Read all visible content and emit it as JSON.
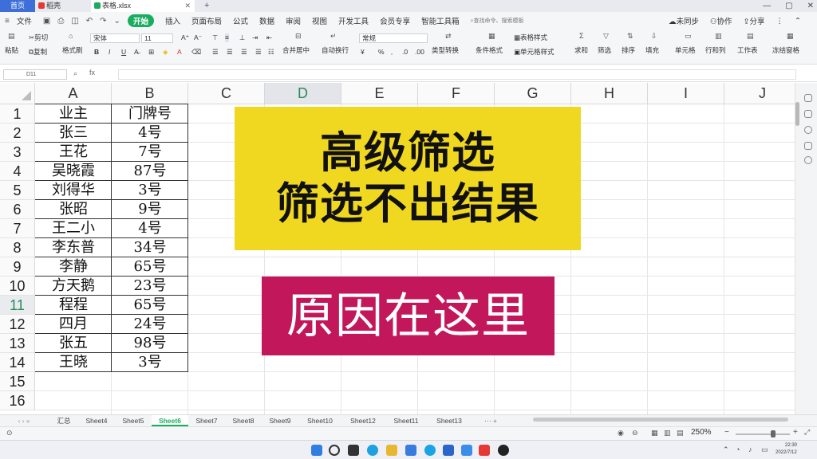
{
  "titlebar": {
    "tabs": [
      {
        "label": "首页"
      },
      {
        "label": "稻壳"
      },
      {
        "label": "表格.xlsx"
      }
    ]
  },
  "menubar": {
    "items": [
      "文件",
      "开始",
      "插入",
      "页面布局",
      "公式",
      "数据",
      "审阅",
      "视图",
      "开发工具",
      "会员专享",
      "智能工具箱"
    ],
    "search_placeholder": "查找命令、搜索模板",
    "right": [
      "未同步",
      "协作",
      "分享"
    ]
  },
  "ribbon": {
    "cut": "剪切",
    "copy": "复制",
    "paste": "粘贴",
    "format_painter": "格式刷",
    "font_name": "宋体",
    "font_size": "11",
    "merge_center": "合并居中",
    "wrap_text": "自动换行",
    "number_format": "常规",
    "type_convert": "类型转换",
    "conditional_format": "条件格式",
    "table_style": "表格样式",
    "cell_style": "单元格样式",
    "sum": "求和",
    "filter": "筛选",
    "sort": "排序",
    "fill": "填充",
    "cell": "单元格",
    "row_col": "行和列",
    "worksheet": "工作表",
    "freeze": "冻结窗格"
  },
  "formula_bar": {
    "name_box": "D11",
    "fx": "fx"
  },
  "grid": {
    "columns": [
      "A",
      "B",
      "C",
      "D",
      "E",
      "F",
      "G",
      "H",
      "I",
      "J"
    ],
    "selected_column": "D",
    "rows": [
      "1",
      "2",
      "3",
      "4",
      "5",
      "6",
      "7",
      "8",
      "9",
      "10",
      "11",
      "12",
      "13",
      "14",
      "15",
      "16"
    ],
    "selected_row": "11",
    "table": [
      [
        "业主",
        "门牌号"
      ],
      [
        "张三",
        "4号"
      ],
      [
        "王花",
        "7号"
      ],
      [
        "吴晓霞",
        "87号"
      ],
      [
        "刘得华",
        "3号"
      ],
      [
        "张昭",
        "9号"
      ],
      [
        "王二小",
        "4号"
      ],
      [
        "李东普",
        "34号"
      ],
      [
        "李静",
        "65号"
      ],
      [
        "方天鹅",
        "23号"
      ],
      [
        "程程",
        "65号"
      ],
      [
        "四月",
        "24号"
      ],
      [
        "张五",
        "98号"
      ],
      [
        "王晓",
        "3号"
      ]
    ]
  },
  "overlay": {
    "line1": "高级筛选",
    "line2": "筛选不出结果",
    "line3": "原因在这里",
    "yellow": "#f1d820",
    "magenta": "#c2185b"
  },
  "sheets": {
    "tabs": [
      "汇总",
      "Sheet4",
      "Sheet5",
      "Sheet6",
      "Sheet7",
      "Sheet8",
      "Sheet9",
      "Sheet10",
      "Sheet12",
      "Sheet11",
      "Sheet13"
    ],
    "active": "Sheet6"
  },
  "statusbar": {
    "zoom": "250%"
  },
  "taskbar": {
    "time": "22:30",
    "date": "2022/7/12"
  },
  "colors": {
    "accent_green": "#1aad60",
    "tab_blue": "#3e6fd9"
  }
}
